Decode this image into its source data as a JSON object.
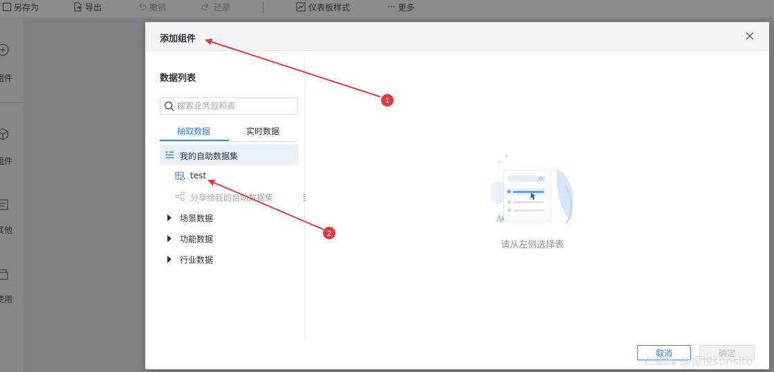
{
  "toolbar": {
    "save_as": "另存为",
    "export": "导出",
    "undo": "撤销",
    "redo": "还原",
    "dashboard_style": "仪表板样式",
    "more": "更多"
  },
  "leftbar": {
    "items": [
      {
        "label": "组件"
      },
      {
        "label": "组件"
      },
      {
        "label": "其他"
      },
      {
        "label": "使用"
      }
    ]
  },
  "dialog": {
    "title": "添加组件",
    "panel_title": "数据列表",
    "search_placeholder": "搜索业务包和表",
    "tabs": [
      "抽取数据",
      "实时数据"
    ],
    "active_tab": "抽取数据",
    "tree": {
      "my_dataset": "我的自助数据集",
      "test": "test",
      "shared": "分享给我的自助数据集",
      "scene": "场景数据",
      "function": "功能数据",
      "industry": "行业数据"
    },
    "empty_text": "请从左侧选择表",
    "cancel": "取消",
    "ok": "确定"
  },
  "annotations": {
    "marker_1": "1",
    "marker_2": "2",
    "color": "#e8383d"
  },
  "watermark": "CSDN @恒悦sunsite",
  "colors": {
    "accent": "#3685f2",
    "selected_bg": "#ebf1fb"
  }
}
